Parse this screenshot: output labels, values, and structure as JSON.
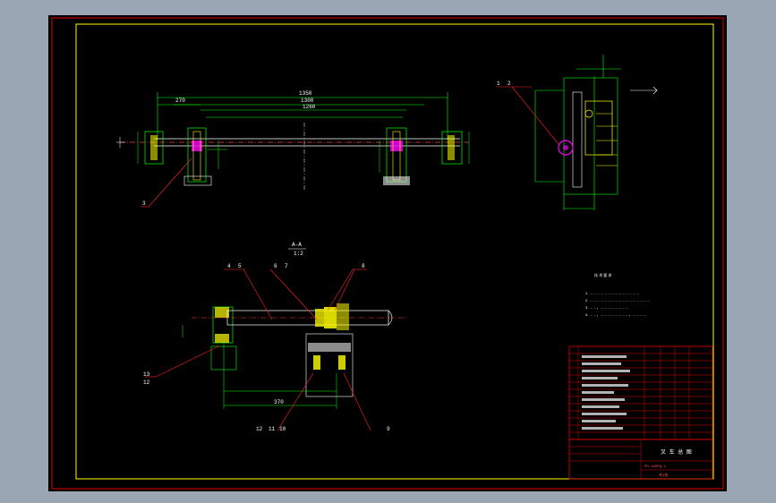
{
  "sheet": {
    "section_label": "A-A",
    "section_scale": "1:2",
    "notes_title": "技 术 要 求",
    "notes": [
      "1. ……………………………………",
      "2. ……………………………………………",
      "3. ……，……………………",
      "4. ……，……………………，…………"
    ]
  },
  "callouts": {
    "top_left": "3",
    "right_1": "1",
    "right_2": "2",
    "c4": "4",
    "c5": "5",
    "c6": "6",
    "c7": "7",
    "c8": "8",
    "c13": "13",
    "c12": "12",
    "c12b": "12",
    "c11": "11",
    "c10": "10",
    "c9": "9"
  },
  "dims": {
    "overall_top": "1350",
    "span_2": "1300",
    "span_3": "1260",
    "left_short": "270",
    "vertical_label": "Φ50",
    "bottom_span": "370"
  },
  "title_block": {
    "name": "叉 车 总 图",
    "drawing_no": "PD-1#SFQ-1",
    "sheet_note": "共1张"
  },
  "colors": {
    "frame_red": "#e00000",
    "frame_yellow": "#ffff00",
    "line_green": "#00ff00",
    "line_white": "#ffffff",
    "part_magenta": "#ff00ff",
    "callout_red": "#ff2020"
  }
}
